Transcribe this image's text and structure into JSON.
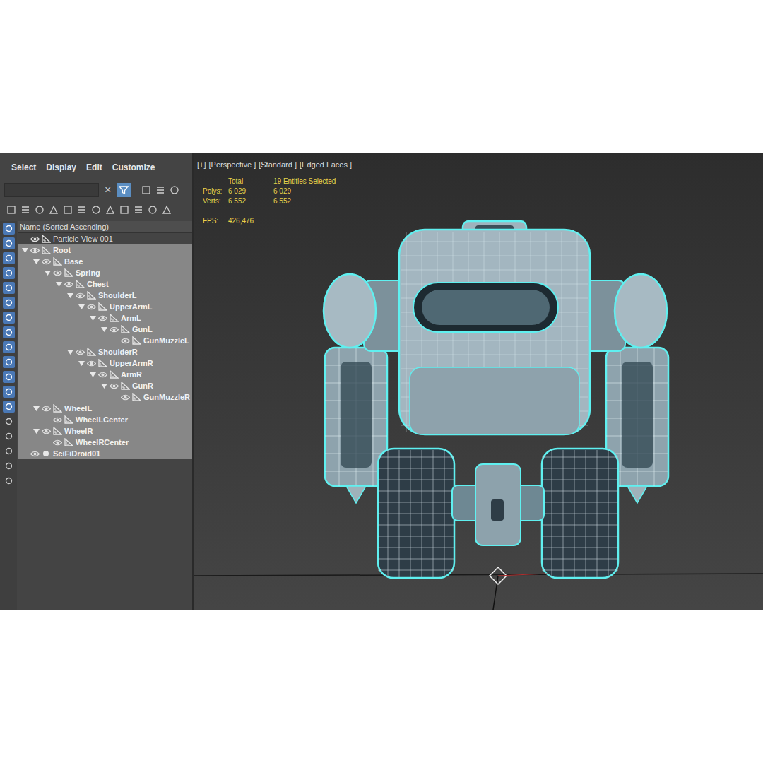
{
  "menu": [
    "Select",
    "Display",
    "Edit",
    "Customize"
  ],
  "search": {
    "value": "",
    "clear": "×",
    "filter_active": true
  },
  "side_tools": [
    {
      "active": true
    },
    {
      "active": true
    },
    {
      "active": true
    },
    {
      "active": true
    },
    {
      "active": true
    },
    {
      "active": true
    },
    {
      "active": true
    },
    {
      "active": true
    },
    {
      "active": true
    },
    {
      "active": true
    },
    {
      "active": true
    },
    {
      "active": true
    },
    {
      "active": true
    },
    {
      "active": false
    },
    {
      "active": false
    },
    {
      "active": false
    },
    {
      "active": false
    },
    {
      "active": false
    }
  ],
  "explorer": {
    "header": "Name (Sorted Ascending)",
    "rows": [
      {
        "name": "Particle View 001",
        "depth": 0,
        "expandable": false,
        "expanded": false,
        "selected": false,
        "kind": "helper"
      },
      {
        "name": "Root",
        "depth": 0,
        "expandable": true,
        "expanded": true,
        "selected": true,
        "kind": "helper"
      },
      {
        "name": "Base",
        "depth": 1,
        "expandable": true,
        "expanded": true,
        "selected": true,
        "kind": "helper"
      },
      {
        "name": "Spring",
        "depth": 2,
        "expandable": true,
        "expanded": true,
        "selected": true,
        "kind": "helper"
      },
      {
        "name": "Chest",
        "depth": 3,
        "expandable": true,
        "expanded": true,
        "selected": true,
        "kind": "helper"
      },
      {
        "name": "ShoulderL",
        "depth": 4,
        "expandable": true,
        "expanded": true,
        "selected": true,
        "kind": "helper"
      },
      {
        "name": "UpperArmL",
        "depth": 5,
        "expandable": true,
        "expanded": true,
        "selected": true,
        "kind": "helper"
      },
      {
        "name": "ArmL",
        "depth": 6,
        "expandable": true,
        "expanded": true,
        "selected": true,
        "kind": "helper"
      },
      {
        "name": "GunL",
        "depth": 7,
        "expandable": true,
        "expanded": true,
        "selected": true,
        "kind": "helper"
      },
      {
        "name": "GunMuzzleL",
        "depth": 8,
        "expandable": false,
        "expanded": false,
        "selected": true,
        "kind": "helper"
      },
      {
        "name": "ShoulderR",
        "depth": 4,
        "expandable": true,
        "expanded": true,
        "selected": true,
        "kind": "helper"
      },
      {
        "name": "UpperArmR",
        "depth": 5,
        "expandable": true,
        "expanded": true,
        "selected": true,
        "kind": "helper"
      },
      {
        "name": "ArmR",
        "depth": 6,
        "expandable": true,
        "expanded": true,
        "selected": true,
        "kind": "helper"
      },
      {
        "name": "GunR",
        "depth": 7,
        "expandable": true,
        "expanded": true,
        "selected": true,
        "kind": "helper"
      },
      {
        "name": "GunMuzzleR",
        "depth": 8,
        "expandable": false,
        "expanded": false,
        "selected": true,
        "kind": "helper"
      },
      {
        "name": "WheelL",
        "depth": 1,
        "expandable": true,
        "expanded": true,
        "selected": true,
        "kind": "helper"
      },
      {
        "name": "WheelLCenter",
        "depth": 2,
        "expandable": false,
        "expanded": false,
        "selected": true,
        "kind": "helper"
      },
      {
        "name": "WheelR",
        "depth": 1,
        "expandable": true,
        "expanded": true,
        "selected": true,
        "kind": "helper"
      },
      {
        "name": "WheelRCenter",
        "depth": 2,
        "expandable": false,
        "expanded": false,
        "selected": true,
        "kind": "helper"
      },
      {
        "name": "SciFiDroid01",
        "depth": 0,
        "expandable": false,
        "expanded": false,
        "selected": true,
        "kind": "mesh"
      }
    ]
  },
  "viewport": {
    "labels": [
      "[+]",
      "[Perspective ]",
      "[Standard ]",
      "[Edged Faces ]"
    ],
    "stats": [
      [
        "",
        "Total",
        "19 Entities Selected"
      ],
      [
        "Polys:",
        "6 029",
        "6 029"
      ],
      [
        "Verts:",
        "6 552",
        "6 552"
      ]
    ],
    "fps": {
      "label": "FPS:",
      "value": "426,476"
    }
  }
}
